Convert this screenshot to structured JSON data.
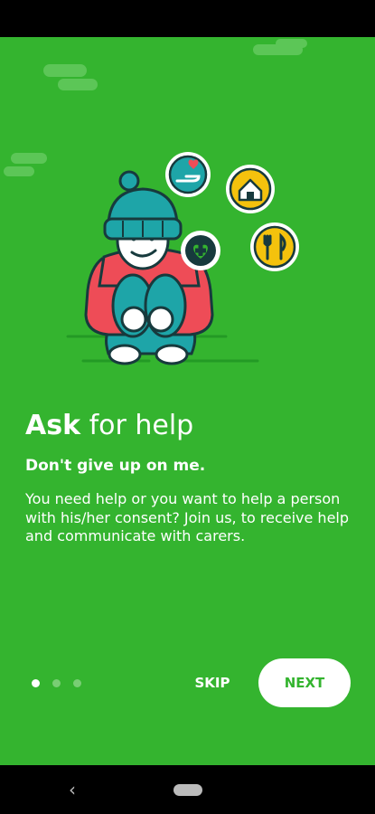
{
  "onboarding": {
    "heading_bold": "Ask",
    "heading_rest": " for help",
    "subtitle": "Don't give up on me.",
    "description": "You need help or you want to help a person with his/her consent? Join us, to receive help and communicate with carers.",
    "page_indicator": {
      "current": 1,
      "total": 3
    },
    "skip_label": "SKIP",
    "next_label": "NEXT"
  },
  "icons": [
    "giving-hand-heart-icon",
    "home-icon",
    "medical-heart-icon",
    "food-utensils-icon",
    "back-icon",
    "home-pill-icon"
  ],
  "colors": {
    "background": "#34b42f",
    "cloud": "#5cc657",
    "teal": "#1ea5a8",
    "red_sweater": "#ee4c57",
    "yellow": "#f4c20d",
    "dark_outline": "#173a3d"
  }
}
